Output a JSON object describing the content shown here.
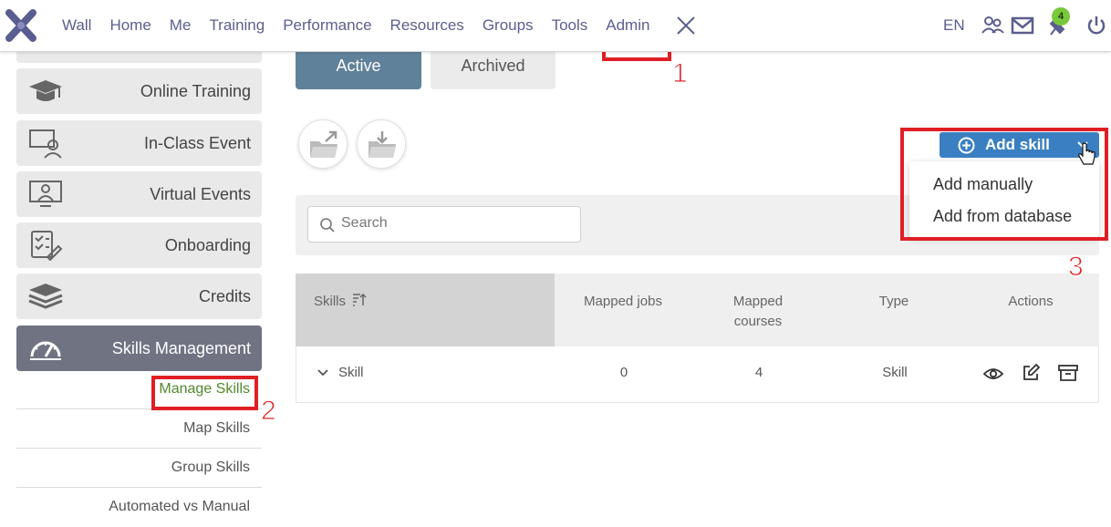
{
  "topnav": {
    "items": [
      "Wall",
      "Home",
      "Me",
      "Training",
      "Performance",
      "Resources",
      "Groups",
      "Tools",
      "Admin"
    ],
    "language": "EN",
    "notification_count": "4"
  },
  "sidebar": {
    "cards": [
      {
        "label": "Online Training",
        "icon": "graduation-cap-icon"
      },
      {
        "label": "In-Class Event",
        "icon": "classroom-presenter-icon"
      },
      {
        "label": "Virtual Events",
        "icon": "monitor-presenter-icon"
      },
      {
        "label": "Onboarding",
        "icon": "checklist-icon"
      },
      {
        "label": "Credits",
        "icon": "stacked-layers-icon"
      },
      {
        "label": "Skills Management",
        "icon": "gauge-icon"
      }
    ],
    "subitems": [
      "Manage Skills",
      "Map Skills",
      "Group Skills",
      "Automated vs Manual"
    ]
  },
  "tabs": {
    "active": "Active",
    "archived": "Archived"
  },
  "add_skill": {
    "label": "Add skill",
    "options": [
      "Add manually",
      "Add from database"
    ]
  },
  "search": {
    "placeholder": "Search"
  },
  "table": {
    "headers": {
      "skills": "Skills",
      "mapped_jobs": "Mapped jobs",
      "mapped_courses_1": "Mapped",
      "mapped_courses_2": "courses",
      "type": "Type",
      "actions": "Actions"
    },
    "rows": [
      {
        "skill": "Skill",
        "mapped_jobs": "0",
        "mapped_courses": "4",
        "type": "Skill"
      }
    ]
  },
  "annotations": [
    "1",
    "2",
    "3"
  ],
  "colors": {
    "nav_text": "#5c5e8e",
    "active_tab": "#5f8199",
    "add_skill_button": "#3a7fc1",
    "sidebar_active": "#707381",
    "current_subitem": "#4f8a2a",
    "annotation_red": "#e01f25",
    "badge_green": "#79c83b"
  }
}
